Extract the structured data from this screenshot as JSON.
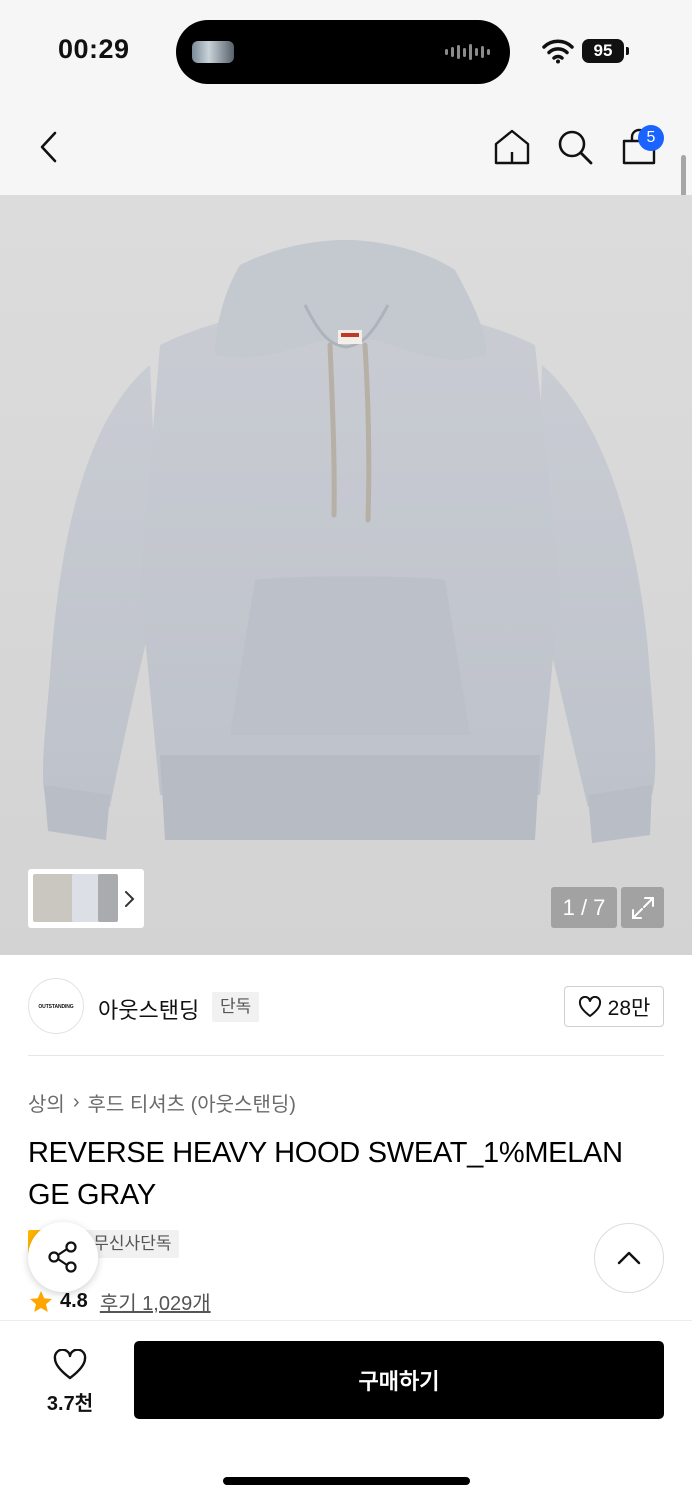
{
  "status": {
    "time": "00:29",
    "battery": "95"
  },
  "nav": {
    "cart_count": "5"
  },
  "gallery": {
    "counter": "1 / 7"
  },
  "brand": {
    "logo_text": "OUTSTANDING",
    "name": "아웃스탠딩",
    "exclusive_tag": "단독",
    "likes": "28만"
  },
  "breadcrumb": {
    "category": "상의",
    "separator": "›",
    "subcategory": "후드 티셔츠 (아웃스탠딩)"
  },
  "product": {
    "title": "REVERSE HEAVY HOOD SWEAT_1%MELAN GE GRAY",
    "sale_tag": "세일",
    "platform_tag": "무신사단독",
    "rating": "4.8",
    "reviews": "후기 1,029개"
  },
  "bottom": {
    "wish_count": "3.7천",
    "buy_label": "구매하기"
  },
  "colors": {
    "accent": "#1a63ff",
    "sale": "#ffb400",
    "star": "#ffa500"
  }
}
